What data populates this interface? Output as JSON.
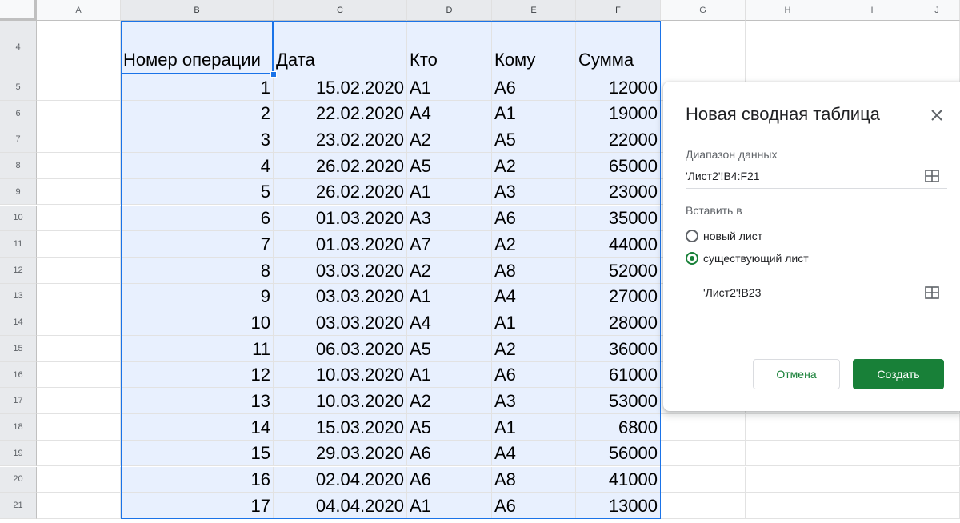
{
  "columns": [
    "A",
    "B",
    "C",
    "D",
    "E",
    "F",
    "G",
    "H",
    "I",
    "J"
  ],
  "selected_columns": [
    "B",
    "C",
    "D",
    "E",
    "F"
  ],
  "rows": [
    "4",
    "5",
    "6",
    "7",
    "8",
    "9",
    "10",
    "11",
    "12",
    "13",
    "14",
    "15",
    "16",
    "17",
    "18",
    "19",
    "20",
    "21"
  ],
  "table": {
    "headers": [
      "Номер операции",
      "Дата",
      "Кто",
      "Кому",
      "Сумма"
    ],
    "records": [
      [
        "1",
        "15.02.2020",
        "A1",
        "A6",
        "12000"
      ],
      [
        "2",
        "22.02.2020",
        "A4",
        "A1",
        "19000"
      ],
      [
        "3",
        "23.02.2020",
        "A2",
        "A5",
        "22000"
      ],
      [
        "4",
        "26.02.2020",
        "A5",
        "A2",
        "65000"
      ],
      [
        "5",
        "26.02.2020",
        "A1",
        "A3",
        "23000"
      ],
      [
        "6",
        "01.03.2020",
        "A3",
        "A6",
        "35000"
      ],
      [
        "7",
        "01.03.2020",
        "A7",
        "A2",
        "44000"
      ],
      [
        "8",
        "03.03.2020",
        "A2",
        "A8",
        "52000"
      ],
      [
        "9",
        "03.03.2020",
        "A1",
        "A4",
        "27000"
      ],
      [
        "10",
        "03.03.2020",
        "A4",
        "A1",
        "28000"
      ],
      [
        "11",
        "06.03.2020",
        "A5",
        "A2",
        "36000"
      ],
      [
        "12",
        "10.03.2020",
        "A1",
        "A6",
        "61000"
      ],
      [
        "13",
        "10.03.2020",
        "A2",
        "A3",
        "53000"
      ],
      [
        "14",
        "15.03.2020",
        "A5",
        "A1",
        "6800"
      ],
      [
        "15",
        "29.03.2020",
        "A6",
        "A4",
        "56000"
      ],
      [
        "16",
        "02.04.2020",
        "A6",
        "A8",
        "41000"
      ],
      [
        "17",
        "04.04.2020",
        "A1",
        "A6",
        "13000"
      ]
    ]
  },
  "dialog": {
    "title": "Новая сводная таблица",
    "close_icon": "close-icon",
    "range_label": "Диапазон данных",
    "range_value": "'Лист2'!B4:F21",
    "insert_label": "Вставить в",
    "option_new": "новый лист",
    "option_existing": "существующий лист",
    "selected_option": "existing",
    "target_value": "'Лист2'!B23",
    "grid_icon": "grid-select-icon",
    "cancel_label": "Отмена",
    "create_label": "Создать",
    "accent_color": "#188038"
  },
  "selection_color": "#1a73e8"
}
